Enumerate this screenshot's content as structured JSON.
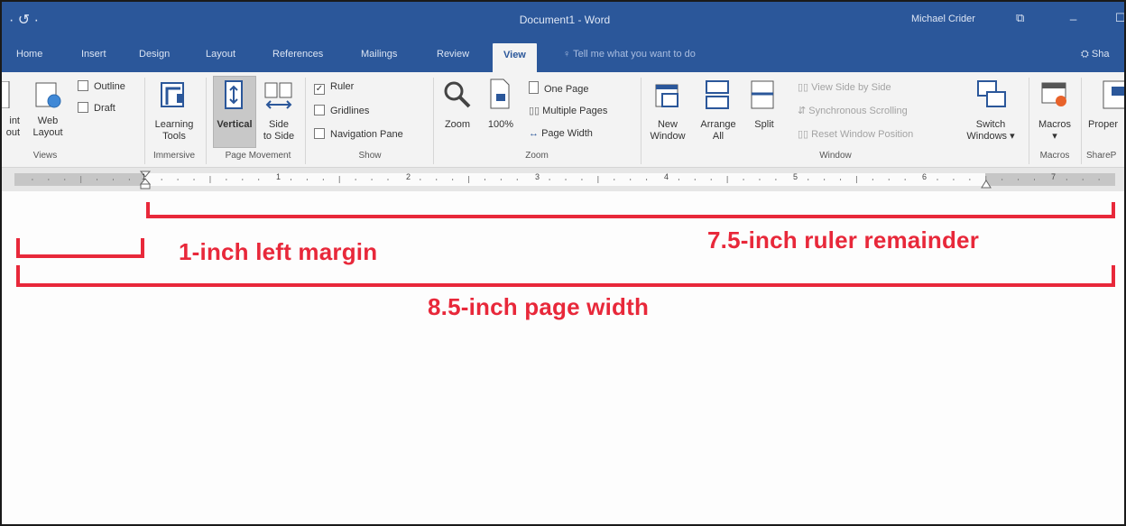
{
  "titlebar": {
    "qat": "·  ↺  ·",
    "title": "Document1  -  Word",
    "user": "Michael Crider",
    "restore_icon": "restore-icon",
    "minimize_icon": "minimize-icon"
  },
  "tabs": [
    {
      "label": "Home"
    },
    {
      "label": "Insert"
    },
    {
      "label": "Design"
    },
    {
      "label": "Layout"
    },
    {
      "label": "References"
    },
    {
      "label": "Mailings"
    },
    {
      "label": "Review"
    },
    {
      "label": "View",
      "active": true
    }
  ],
  "tellme": "Tell me what you want to do",
  "share": "Sha",
  "ribbon": {
    "views": {
      "label": "Views",
      "print_layout": "int\nout",
      "web_layout": "Web\nLayout",
      "outline": "Outline",
      "draft": "Draft"
    },
    "immersive": {
      "label": "Immersive",
      "learning_tools": "Learning\nTools"
    },
    "page_movement": {
      "label": "Page Movement",
      "vertical": "Vertical",
      "side_to_side": "Side\nto Side"
    },
    "show": {
      "label": "Show",
      "ruler": "Ruler",
      "gridlines": "Gridlines",
      "navigation_pane": "Navigation Pane"
    },
    "zoom": {
      "label": "Zoom",
      "zoom": "Zoom",
      "hundred": "100%",
      "one_page": "One Page",
      "multiple_pages": "Multiple Pages",
      "page_width": "Page Width"
    },
    "window": {
      "label": "Window",
      "new_window": "New\nWindow",
      "arrange_all": "Arrange\nAll",
      "split": "Split",
      "view_side_by_side": "View Side by Side",
      "synchronous_scrolling": "Synchronous Scrolling",
      "reset_window_position": "Reset Window Position",
      "switch_windows": "Switch\nWindows ▾"
    },
    "macros": {
      "label": "Macros",
      "macros": "Macros\n▾"
    },
    "sharepoint": {
      "label": "ShareP",
      "properties": "Proper"
    }
  },
  "ruler": {
    "numbers": [
      "1",
      "1",
      "2",
      "3",
      "4",
      "5",
      "6",
      "7"
    ]
  },
  "annotations": {
    "left_margin": "1-inch left margin",
    "ruler_remainder": "7.5-inch ruler remainder",
    "page_width": "8.5-inch page width",
    "color": "#e8283a"
  },
  "colors": {
    "word_blue": "#2b579a",
    "ribbon_bg": "#f3f3f3"
  }
}
